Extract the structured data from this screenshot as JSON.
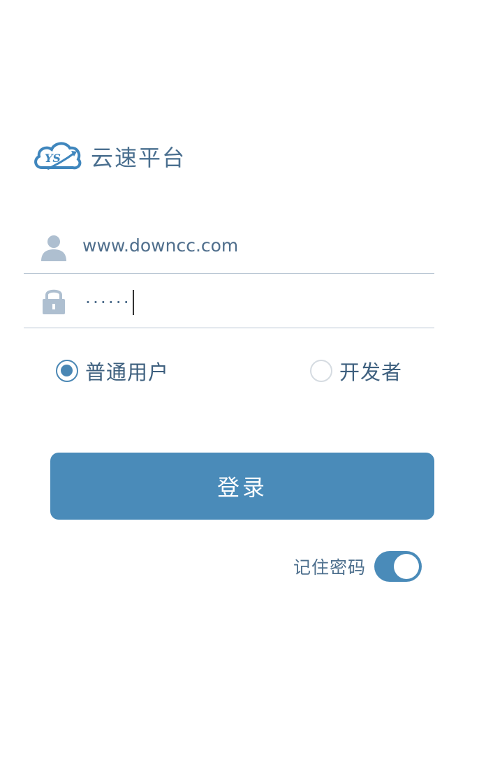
{
  "app": {
    "name": "云速平台",
    "logo_text": "YS",
    "accent_color": "#4a8bb9"
  },
  "login_form": {
    "username": {
      "icon": "person-icon",
      "value": "www.downcc.com"
    },
    "password": {
      "icon": "lock-icon",
      "masked_value": "······"
    }
  },
  "user_type": {
    "options": [
      {
        "label": "普通用户",
        "checked": true
      },
      {
        "label": "开发者",
        "checked": false
      }
    ]
  },
  "login_button": {
    "label": "登录"
  },
  "remember_password": {
    "label": "记住密码",
    "enabled": true
  }
}
